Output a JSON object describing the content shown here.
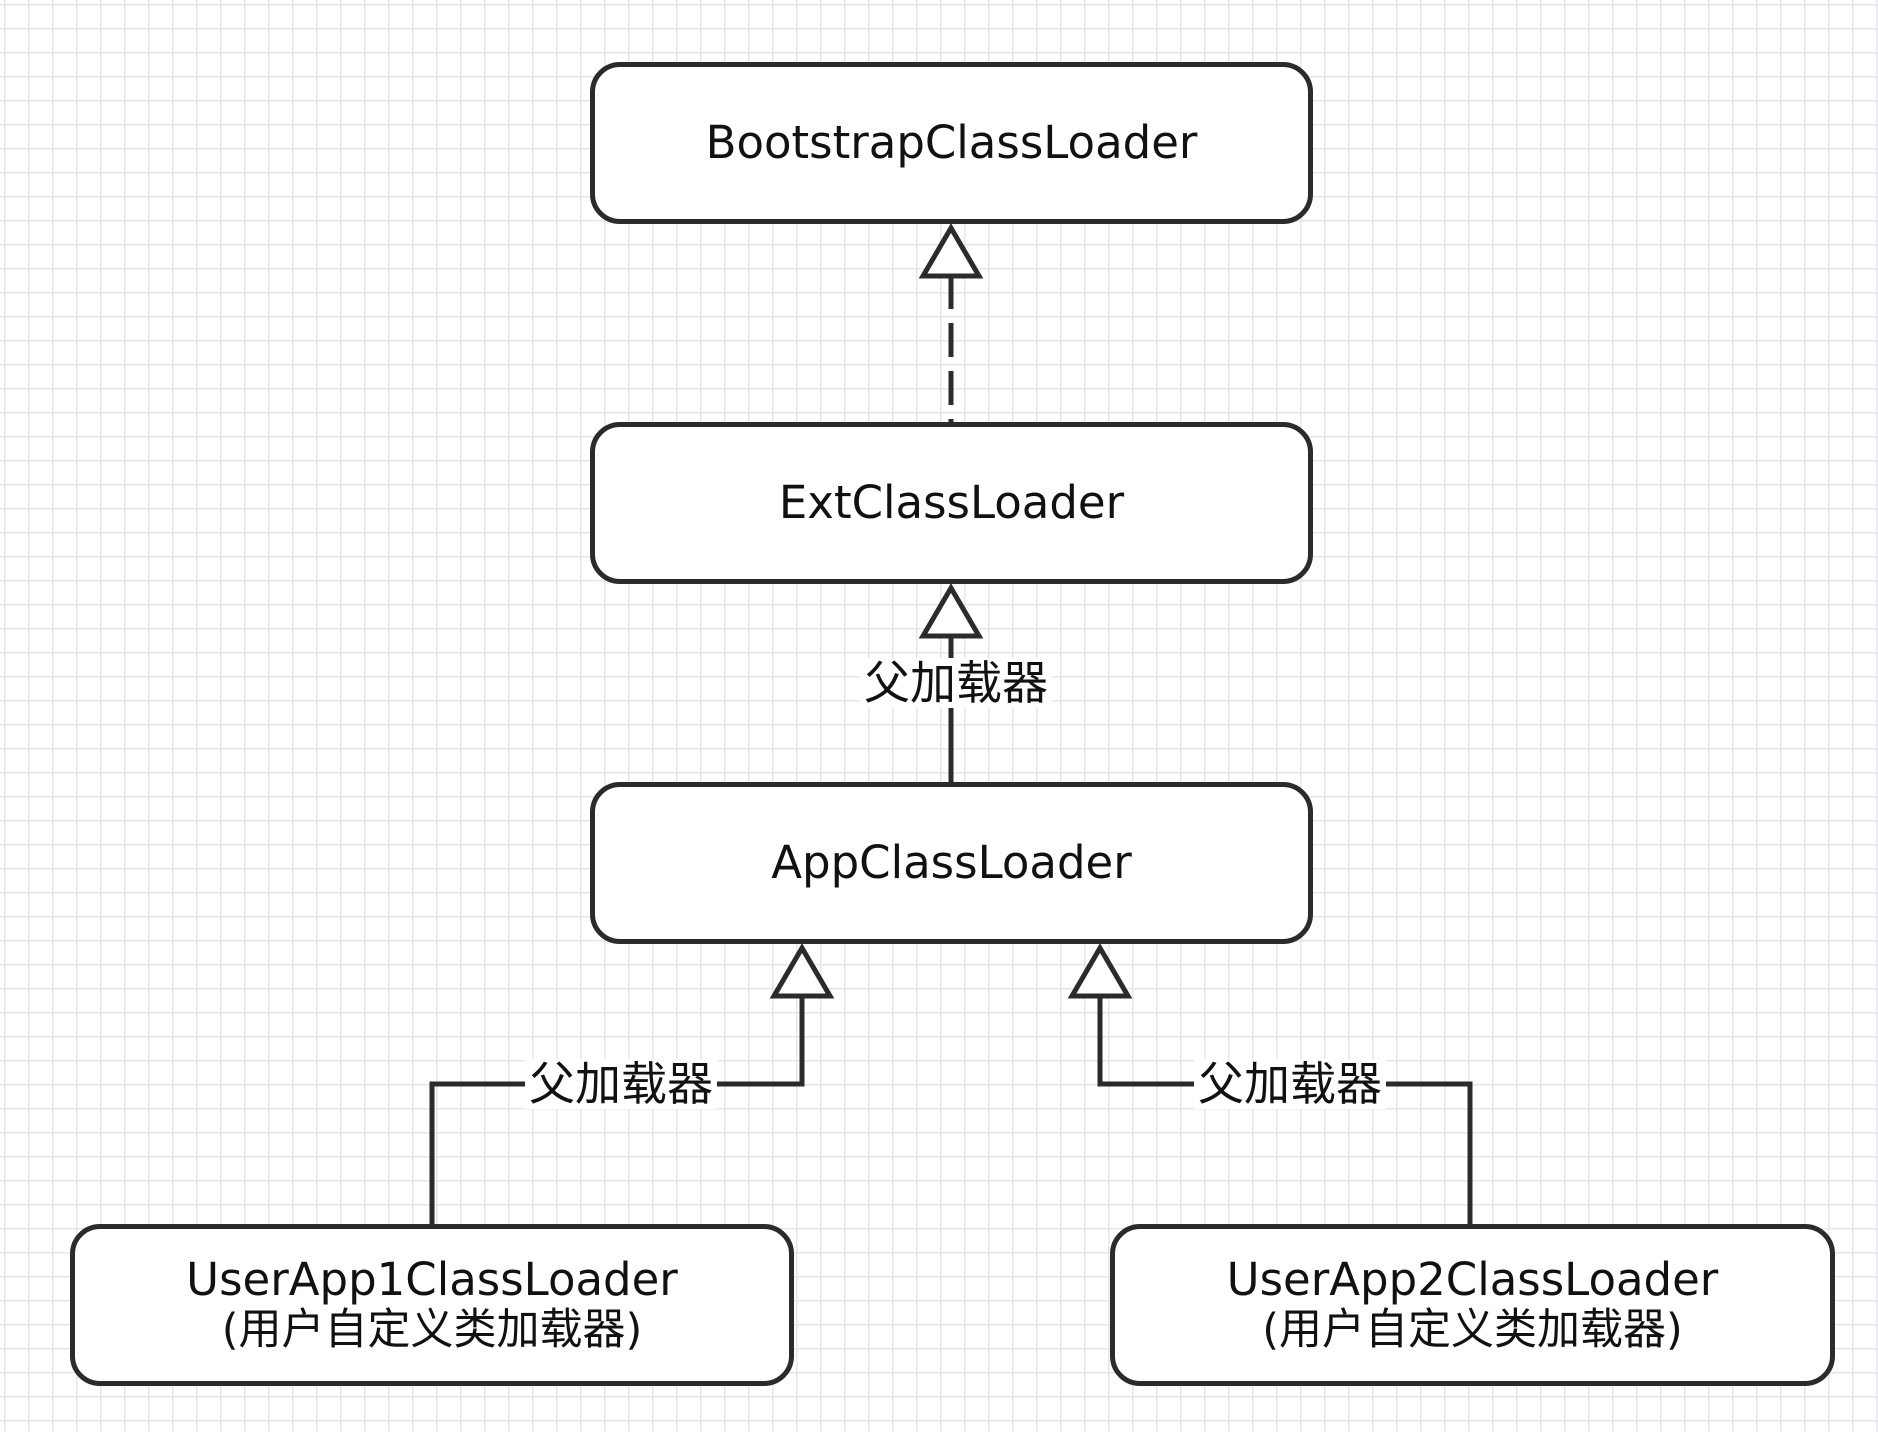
{
  "diagram": {
    "nodes": [
      {
        "id": "bootstrap",
        "label": "BootstrapClassLoader",
        "subtitle": ""
      },
      {
        "id": "ext",
        "label": "ExtClassLoader",
        "subtitle": ""
      },
      {
        "id": "app",
        "label": "AppClassLoader",
        "subtitle": ""
      },
      {
        "id": "user1",
        "label": "UserApp1ClassLoader",
        "subtitle": "(用户自定义类加载器)"
      },
      {
        "id": "user2",
        "label": "UserApp2ClassLoader",
        "subtitle": "(用户自定义类加载器)"
      }
    ],
    "edges": [
      {
        "from": "ext",
        "to": "bootstrap",
        "style": "dashed",
        "arrowhead": "hollow-triangle",
        "label": ""
      },
      {
        "from": "app",
        "to": "ext",
        "style": "solid",
        "arrowhead": "hollow-triangle",
        "label": "父加载器"
      },
      {
        "from": "user1",
        "to": "app",
        "style": "solid",
        "arrowhead": "hollow-triangle",
        "label": "父加载器"
      },
      {
        "from": "user2",
        "to": "app",
        "style": "solid",
        "arrowhead": "hollow-triangle",
        "label": "父加载器"
      }
    ],
    "colors": {
      "background": "#ffffff",
      "grid": "#e4e4f2",
      "stroke": "#2b2b2b",
      "text": "#111111"
    }
  }
}
